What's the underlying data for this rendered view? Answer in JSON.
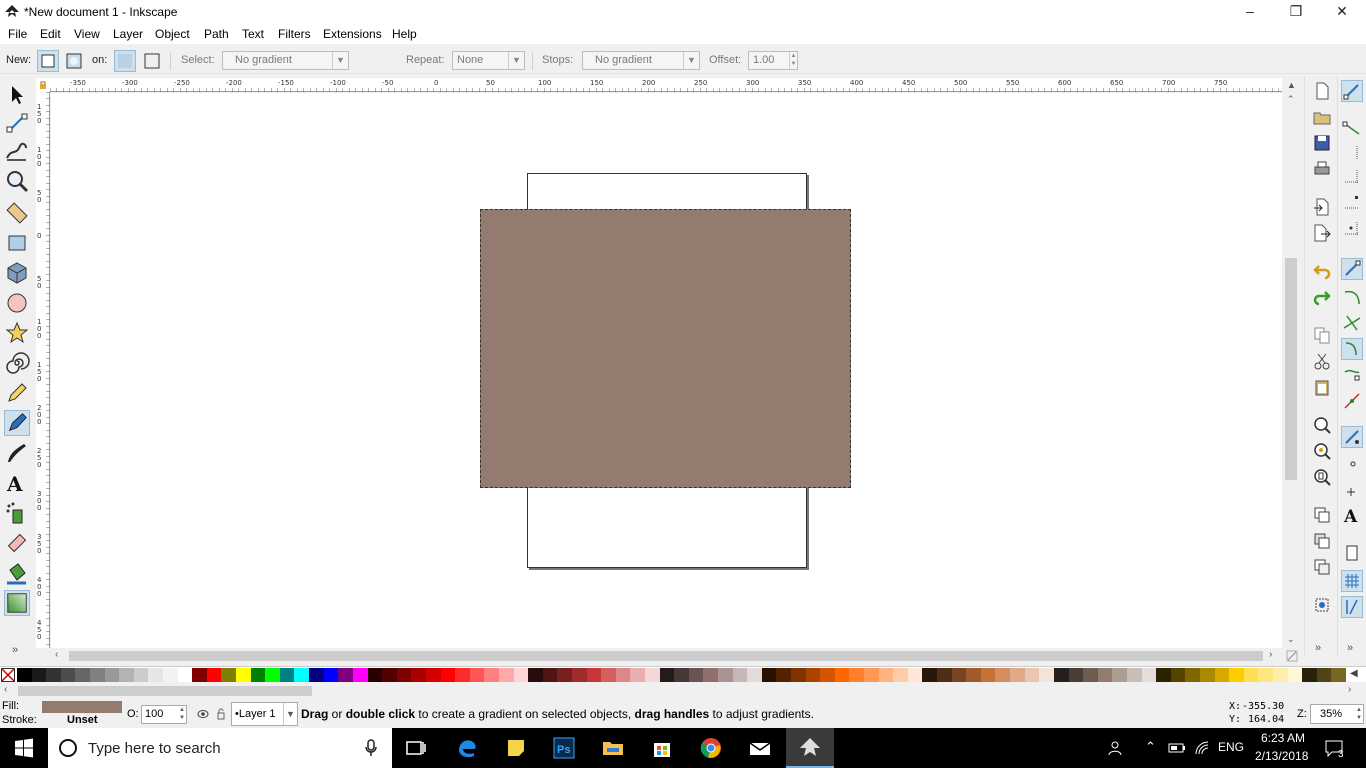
{
  "window": {
    "title": "*New document 1 - Inkscape",
    "minimize": "–",
    "maximize": "❐",
    "close": "✕"
  },
  "menu": [
    "File",
    "Edit",
    "View",
    "Layer",
    "Object",
    "Path",
    "Text",
    "Filters",
    "Extensions",
    "Help"
  ],
  "tool_controls": {
    "new_label": "New:",
    "on_label": "on:",
    "select_label": "Select:",
    "select_value": "No gradient",
    "repeat_label": "Repeat:",
    "repeat_value": "None",
    "stops_label": "Stops:",
    "stops_value": "No gradient",
    "offset_label": "Offset:",
    "offset_value": "1.00"
  },
  "ruler": {
    "h_labels": [
      "-350",
      "-300",
      "-250",
      "-200",
      "-150",
      "-100",
      "-50",
      "0",
      "50",
      "100",
      "150",
      "200",
      "250",
      "300",
      "350",
      "400",
      "450",
      "500",
      "550",
      "600",
      "650",
      "700",
      "750"
    ],
    "v_labels": [
      "150",
      "100",
      "50",
      "0",
      "50",
      "100",
      "150",
      "200",
      "250",
      "300",
      "350",
      "400",
      "450"
    ]
  },
  "colors": {
    "rect_fill": "#937c6f",
    "accent": "#0078d7"
  },
  "palette": [
    "#000000",
    "#1a1a1a",
    "#333333",
    "#4d4d4d",
    "#666666",
    "#808080",
    "#999999",
    "#b3b3b3",
    "#cccccc",
    "#e6e6e6",
    "#f2f2f2",
    "#ffffff",
    "#800000",
    "#ff0000",
    "#808000",
    "#ffff00",
    "#008000",
    "#00ff00",
    "#008080",
    "#00ffff",
    "#000080",
    "#0000ff",
    "#800080",
    "#ff00ff",
    "#2b0000",
    "#550000",
    "#800000",
    "#aa0000",
    "#d40000",
    "#ff0000",
    "#ff2a2a",
    "#ff5555",
    "#ff8080",
    "#ffaaaa",
    "#ffd5d5",
    "#280b0b",
    "#501616",
    "#782121",
    "#a02c2c",
    "#c83737",
    "#d35f5f",
    "#de8787",
    "#e9afaf",
    "#f4d7d7",
    "#241c1c",
    "#483737",
    "#6c5353",
    "#916f6f",
    "#ac9393",
    "#c8b7b7",
    "#e3dbdb",
    "#2b1100",
    "#552200",
    "#803300",
    "#aa4400",
    "#d45500",
    "#ff6600",
    "#ff7f2a",
    "#ff9955",
    "#ffb380",
    "#ffccaa",
    "#ffe6d5",
    "#28170b",
    "#502d16",
    "#784421",
    "#a05a2c",
    "#c87137",
    "#d38d5f",
    "#deaa87",
    "#e9c6af",
    "#f4e3d7",
    "#241f1c",
    "#483e37",
    "#6c5d53",
    "#917c6f",
    "#ac9d93",
    "#c8beb7",
    "#e3dedb",
    "#2b2200",
    "#554400",
    "#806600",
    "#aa8800",
    "#d4aa00",
    "#ffcc00",
    "#ffdd55",
    "#ffe680",
    "#ffeeaa",
    "#fff6d5",
    "#28220b",
    "#504416",
    "#786721"
  ],
  "status": {
    "fill_label": "Fill:",
    "stroke_label": "Stroke:",
    "stroke_value": "Unset",
    "opacity_label": "O:",
    "opacity_value": "100",
    "layer_value": "•Layer 1",
    "message_b1": "Drag",
    "message_t1": " or ",
    "message_b2": "double click",
    "message_t2": " to create a gradient on selected objects, ",
    "message_b3": "drag handles",
    "message_t3": " to adjust gradients.",
    "x_label": "X:",
    "x_value": "-355.30",
    "y_label": "Y:",
    "y_value": "164.04",
    "zoom_label": "Z:",
    "zoom_value": "35%"
  },
  "taskbar": {
    "search_placeholder": "Type here to search",
    "lang": "ENG",
    "time": "6:23 AM",
    "date": "2/13/2018",
    "notification_count": "3"
  }
}
